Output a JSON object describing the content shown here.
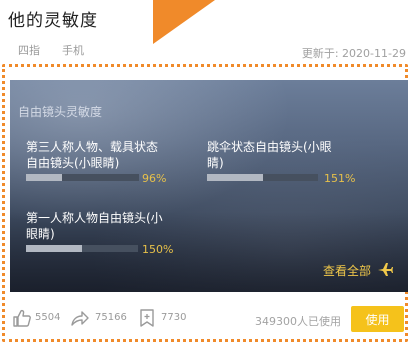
{
  "page_title": "他的灵敏度",
  "tags": [
    "四指",
    "手机"
  ],
  "updated": "更新于: 2020-11-29",
  "card": {
    "heading": "自由镜头灵敏度",
    "settings": [
      {
        "label_lines": [
          "第三人称人物、载具状态",
          "自由镜头(小眼睛)"
        ],
        "value_text": "96%",
        "percent": 96
      },
      {
        "label_lines": [
          "跳伞状态自由镜头(小眼",
          "睛)"
        ],
        "value_text": "151%",
        "percent": 151
      },
      {
        "label_lines": [
          "第一人称人物自由镜头(小",
          "眼睛)"
        ],
        "value_text": "150%",
        "percent": 150
      }
    ],
    "view_all": "查看全部"
  },
  "footer": {
    "likes": "5504",
    "shares": "75166",
    "saves": "7730",
    "users": "349300人已使用",
    "use_button": "使用"
  },
  "colors": {
    "accent_orange": "#f08a2a",
    "button_yellow": "#f5c21b",
    "value_gold": "#e7c14a"
  },
  "icons": {
    "like": "thumb-up-icon",
    "share": "share-arrow-icon",
    "save": "bookmark-icon",
    "view_all": "airplane-icon"
  }
}
